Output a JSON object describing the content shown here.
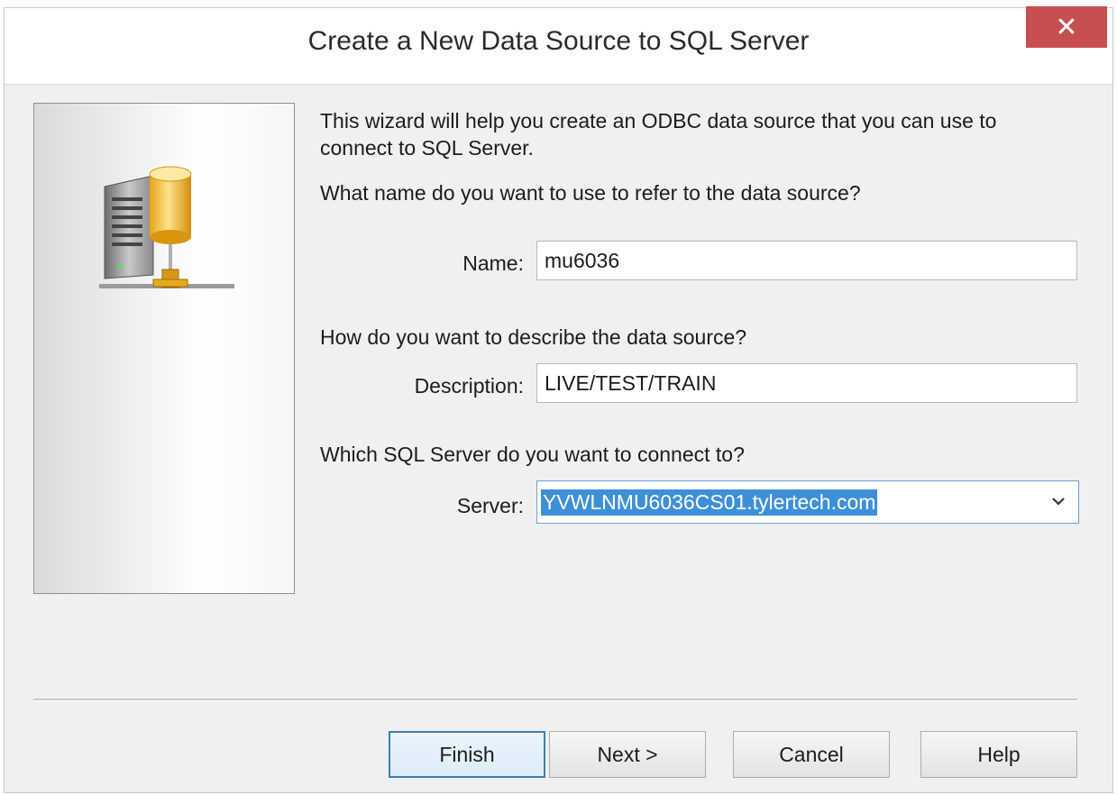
{
  "window": {
    "title": "Create a New Data Source to SQL Server",
    "close_symbol": "✕"
  },
  "intro": {
    "line1": "This wizard will help you create an ODBC data source that you can use to",
    "line2": "connect to SQL Server."
  },
  "name_section": {
    "question": "What name do you want to use to refer to the data source?",
    "label": "Name:",
    "value": "mu6036"
  },
  "description_section": {
    "question": "How do you want to describe the data source?",
    "label": "Description:",
    "value": "LIVE/TEST/TRAIN"
  },
  "server_section": {
    "question": "Which SQL Server do you want to connect to?",
    "label": "Server:",
    "value": "YVWLNMU6036CS01.tylertech.com"
  },
  "buttons": {
    "finish": "Finish",
    "next": "Next >",
    "cancel": "Cancel",
    "help": "Help"
  },
  "icons": {
    "close": "close-icon",
    "server": "database-server-icon",
    "dropdown": "chevron-down-icon"
  },
  "colors": {
    "close_button": "#c74f4f",
    "selection": "#3d8fd8",
    "default_button_border": "#3c7fb1"
  }
}
